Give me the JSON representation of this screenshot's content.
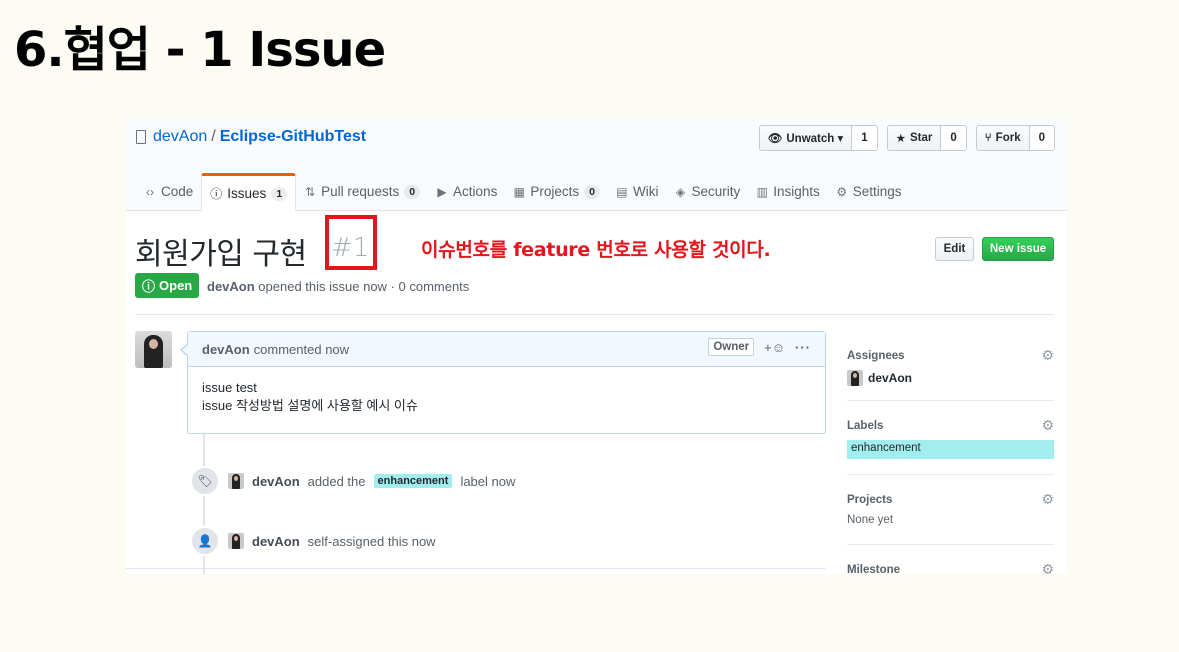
{
  "slide": {
    "title": "6.협업 - 1 Issue"
  },
  "repo": {
    "owner": "devAon",
    "separator": "/",
    "name": "Eclipse-GitHubTest"
  },
  "actions": {
    "watch": {
      "icon": "eye-icon",
      "label": "Unwatch ▾",
      "count": "1"
    },
    "star": {
      "icon": "star-icon",
      "label": "Star",
      "count": "0"
    },
    "fork": {
      "icon": "fork-icon",
      "label": "Fork",
      "count": "0"
    }
  },
  "tabs": [
    {
      "icon": "code-icon",
      "label": "Code"
    },
    {
      "icon": "issue-opened-icon",
      "label": "Issues",
      "counter": "1",
      "selected": true
    },
    {
      "icon": "pull-request-icon",
      "label": "Pull requests",
      "counter": "0"
    },
    {
      "icon": "play-icon",
      "label": "Actions"
    },
    {
      "icon": "project-icon",
      "label": "Projects",
      "counter": "0"
    },
    {
      "icon": "book-icon",
      "label": "Wiki"
    },
    {
      "icon": "shield-icon",
      "label": "Security"
    },
    {
      "icon": "graph-icon",
      "label": "Insights"
    },
    {
      "icon": "gear-icon",
      "label": "Settings"
    }
  ],
  "issue": {
    "title": "회원가입 구현",
    "number": "#1",
    "annotation": "이슈번호를 feature 번호로 사용할 것이다.",
    "edit_label": "Edit",
    "new_issue_label": "New issue",
    "state": "Open",
    "author": "devAon",
    "meta": "opened this issue now · 0 comments"
  },
  "comment": {
    "author": "devAon",
    "action": "commented now",
    "owner_badge": "Owner",
    "reaction": "+☺",
    "more": "···",
    "body_lines": [
      "issue test",
      "issue 작성방법 설명에 사용할 예시 이슈"
    ]
  },
  "events": [
    {
      "icon": "tag-icon",
      "author": "devAon",
      "before": "added the",
      "label": "enhancement",
      "after": "label now"
    },
    {
      "icon": "person-icon",
      "author": "devAon",
      "text": "self-assigned this now"
    }
  ],
  "sidebar": {
    "assignees": {
      "heading": "Assignees",
      "value": "devAon"
    },
    "labels": {
      "heading": "Labels",
      "value": "enhancement",
      "color": "#a2eeef"
    },
    "projects": {
      "heading": "Projects",
      "value": "None yet"
    },
    "milestone": {
      "heading": "Milestone"
    }
  },
  "colors": {
    "open_green": "#28a745",
    "annotation_red": "#e3161c",
    "link_blue": "#0366d6",
    "tab_accent": "#e36209"
  }
}
